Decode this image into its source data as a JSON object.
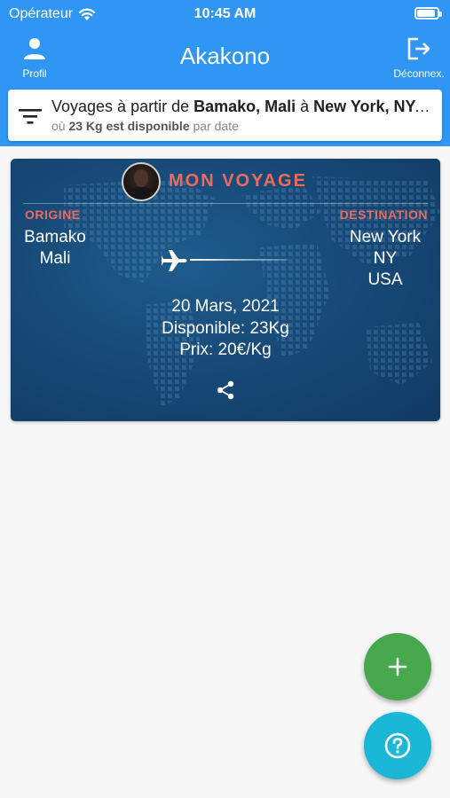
{
  "status_bar": {
    "carrier": "Opérateur",
    "time": "10:45 AM"
  },
  "app_bar": {
    "title": "Akakono",
    "profile_label": "Profil",
    "logout_label": "Déconnex."
  },
  "filter": {
    "prefix": "Voyages à partir de ",
    "origin": "Bamako, Mali",
    "connector": " à ",
    "destination": "New York, NY, USA",
    "line2_prefix": "où ",
    "weight_text": "23 Kg est disponible",
    "line2_suffix": " par date"
  },
  "trip_card": {
    "title": "MON VOYAGE",
    "origin_label": "ORIGINE",
    "destination_label": "DESTINATION",
    "origin": [
      "Bamako",
      "Mali"
    ],
    "destination": [
      "New York",
      "NY",
      "USA"
    ],
    "date": "20 Mars, 2021",
    "available": "Disponible: 23Kg",
    "price": "Prix: 20€/Kg"
  },
  "fabs": {
    "add": "+",
    "help": "?"
  },
  "colors": {
    "app_bar": "#2f96f3",
    "card_bg": "#174a78",
    "accent_red": "#ee6a5d",
    "fab_add": "#48a84e",
    "fab_help": "#1ab7d6"
  }
}
